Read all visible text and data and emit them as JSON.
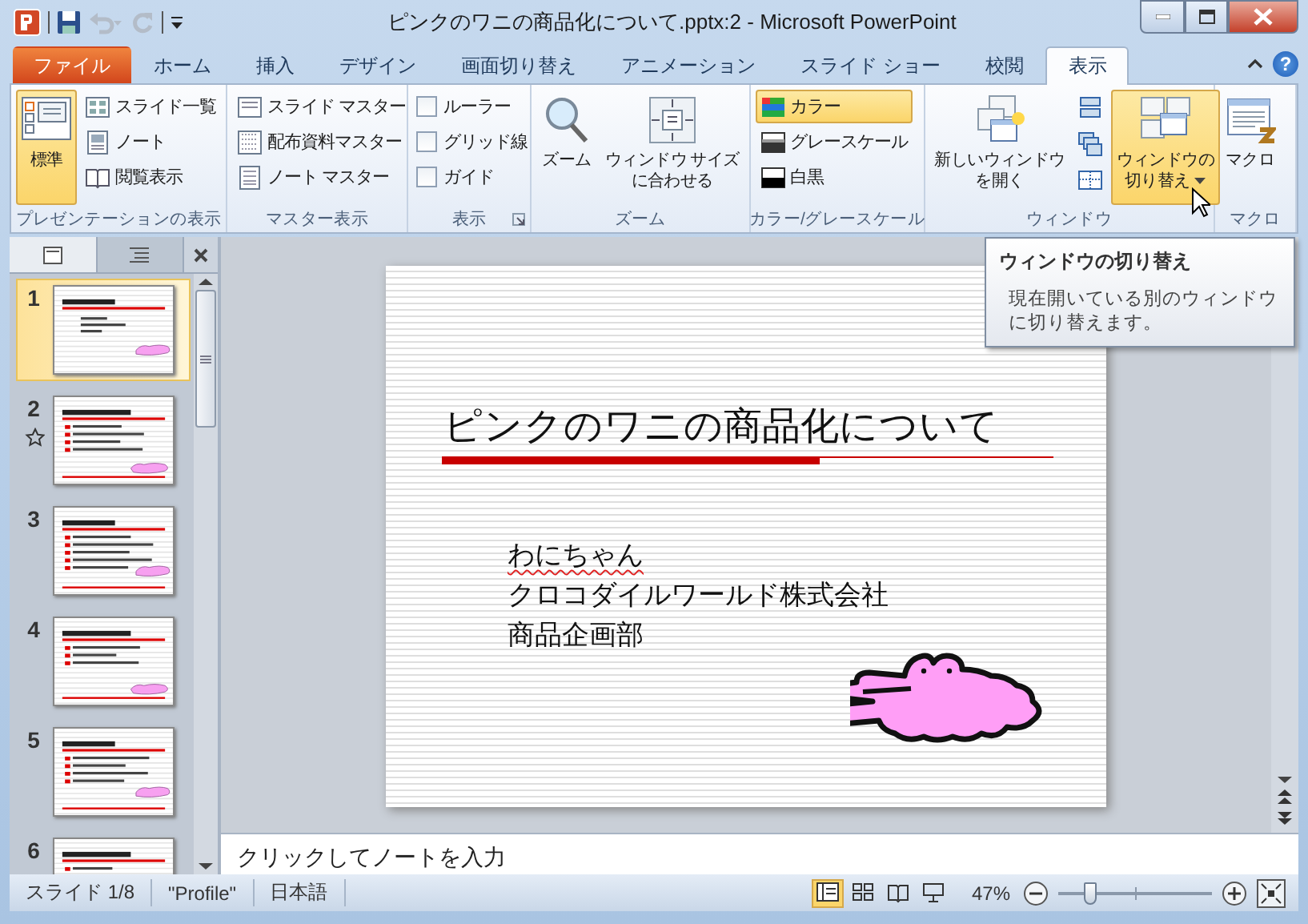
{
  "window": {
    "title": "ピンクのワニの商品化について.pptx:2 - Microsoft PowerPoint"
  },
  "tabs": [
    {
      "label": "ファイル",
      "kind": "file",
      "selected": false
    },
    {
      "label": "ホーム",
      "kind": "tab",
      "selected": false
    },
    {
      "label": "挿入",
      "kind": "tab",
      "selected": false
    },
    {
      "label": "デザイン",
      "kind": "tab",
      "selected": false
    },
    {
      "label": "画面切り替え",
      "kind": "tab",
      "selected": false
    },
    {
      "label": "アニメーション",
      "kind": "tab",
      "selected": false
    },
    {
      "label": "スライド ショー",
      "kind": "tab",
      "selected": false
    },
    {
      "label": "校閲",
      "kind": "tab",
      "selected": false
    },
    {
      "label": "表示",
      "kind": "tab",
      "selected": true
    }
  ],
  "help": "?",
  "ribbon": [
    {
      "label": "プレゼンテーションの表示",
      "items": [
        {
          "kind": "large",
          "lines": [
            "標準"
          ],
          "selected": true
        },
        {
          "kind": "small",
          "label": "スライド一覧",
          "selected": false
        },
        {
          "kind": "small",
          "label": "ノート",
          "selected": false
        },
        {
          "kind": "small",
          "label": "閲覧表示",
          "selected": false
        }
      ]
    },
    {
      "label": "マスター表示",
      "items": [
        {
          "kind": "small",
          "label": "スライド マスター",
          "selected": false
        },
        {
          "kind": "small",
          "label": "配布資料マスター",
          "selected": false
        },
        {
          "kind": "small",
          "label": "ノート マスター",
          "selected": false
        }
      ]
    },
    {
      "label": "表示",
      "launcher": true,
      "items": [
        {
          "kind": "check",
          "label": "ルーラー",
          "checked": false
        },
        {
          "kind": "check",
          "label": "グリッド線",
          "checked": false
        },
        {
          "kind": "check",
          "label": "ガイド",
          "checked": false
        }
      ]
    },
    {
      "label": "ズーム",
      "items": [
        {
          "kind": "large",
          "lines": [
            "ズーム"
          ],
          "selected": false
        },
        {
          "kind": "large",
          "lines": [
            "ウィンドウ サイズ",
            "に合わせる"
          ],
          "selected": false
        }
      ]
    },
    {
      "label": "カラー/グレースケール",
      "items": [
        {
          "kind": "small",
          "label": "カラー",
          "selected": true
        },
        {
          "kind": "small",
          "label": "グレースケール",
          "selected": false
        },
        {
          "kind": "small",
          "label": "白黒",
          "selected": false
        }
      ]
    },
    {
      "label": "ウィンドウ",
      "items": [
        {
          "kind": "large",
          "lines": [
            "新しいウィンドウ",
            "を開く"
          ],
          "selected": false
        },
        {
          "kind": "icon",
          "selected": false
        },
        {
          "kind": "icon",
          "selected": false
        },
        {
          "kind": "icon",
          "selected": false
        },
        {
          "kind": "large",
          "lines": [
            "ウィンドウの",
            "切り替え"
          ],
          "selected": true,
          "menu": true
        }
      ]
    },
    {
      "label": "マクロ",
      "items": [
        {
          "kind": "large",
          "lines": [
            "マクロ"
          ],
          "selected": false
        }
      ]
    }
  ],
  "thumbnails": [
    {
      "number": "1",
      "selected": true,
      "transition": false
    },
    {
      "number": "2",
      "selected": false,
      "transition": true
    },
    {
      "number": "3",
      "selected": false,
      "transition": false
    },
    {
      "number": "4",
      "selected": false,
      "transition": false
    },
    {
      "number": "5",
      "selected": false,
      "transition": false
    },
    {
      "number": "6",
      "selected": false,
      "transition": false
    }
  ],
  "slide": {
    "title": "ピンクのワニの商品化について",
    "lines": [
      {
        "text": "わにちゃん",
        "spelling_error": true
      },
      {
        "text": "クロコダイルワールド株式会社",
        "spelling_error": false
      },
      {
        "text": "商品企画部",
        "spelling_error": false
      }
    ]
  },
  "notes": {
    "placeholder": "クリックしてノートを入力"
  },
  "tooltip": {
    "title": "ウィンドウの切り替え",
    "body": "現在開いている別のウィンドウに切り替えます。"
  },
  "status": {
    "slide": "スライド 1/8",
    "theme": "\"Profile\"",
    "language": "日本語",
    "views": [
      {
        "selected": true
      },
      {
        "selected": false
      },
      {
        "selected": false
      },
      {
        "selected": false
      }
    ],
    "zoom": "47%",
    "zoom_slider": {
      "level": 0.21
    }
  }
}
